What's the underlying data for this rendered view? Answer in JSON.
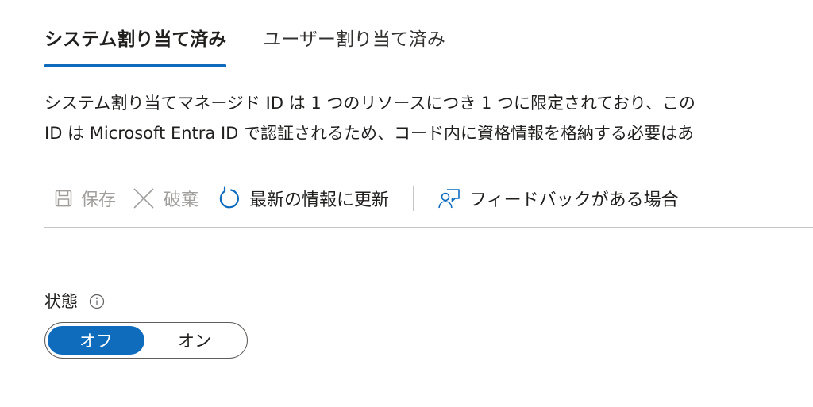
{
  "tabs": [
    {
      "label": "システム割り当て済み",
      "active": true
    },
    {
      "label": "ユーザー割り当て済み",
      "active": false
    }
  ],
  "description": {
    "line1": "システム割り当てマネージド ID は 1 つのリソースにつき 1 つに限定されており、この",
    "line2": "ID は Microsoft Entra ID で認証されるため、コード内に資格情報を格納する必要はあ"
  },
  "toolbar": {
    "save_label": "保存",
    "discard_label": "破棄",
    "refresh_label": "最新の情報に更新",
    "feedback_label": "フィードバックがある場合",
    "icons": {
      "save": "save-icon",
      "discard": "close-icon",
      "refresh": "refresh-icon",
      "feedback": "feedback-icon"
    }
  },
  "status": {
    "label": "状態",
    "info_icon": "info-icon",
    "options": [
      "オフ",
      "オン"
    ],
    "selected": "オフ"
  },
  "colors": {
    "accent": "#0f6cbd",
    "disabled_text": "#a19f9d",
    "text": "#201f1e",
    "divider": "#c8c6c4"
  }
}
